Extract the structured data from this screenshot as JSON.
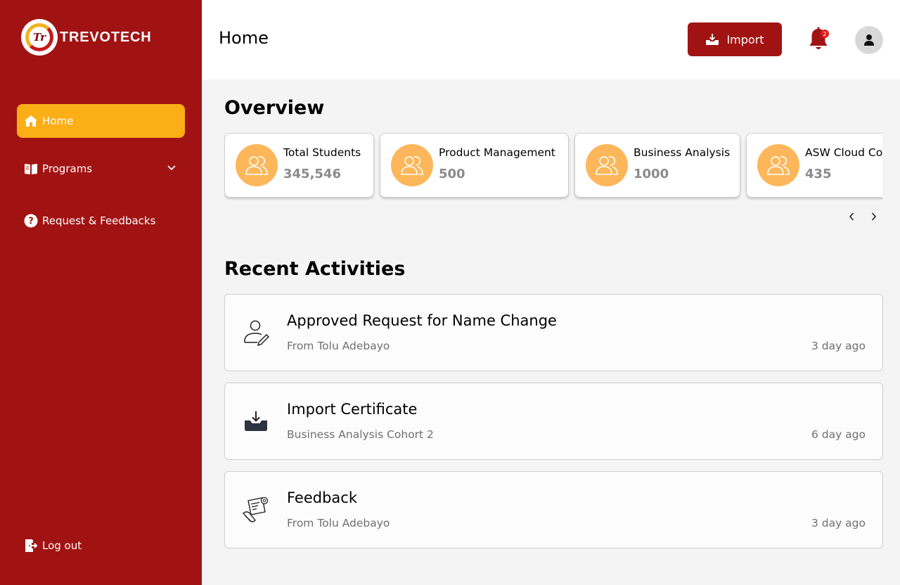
{
  "brand": {
    "name": "TREVOTECH",
    "logo_letters": "Tr"
  },
  "colors": {
    "sidebar": "#a11313",
    "accent": "#fcae17",
    "card_circle": "#fdb75a",
    "badge": "#e21b1b"
  },
  "sidebar": {
    "items": [
      {
        "label": "Home",
        "icon": "home-icon",
        "active": true
      },
      {
        "label": "Programs",
        "icon": "book-icon",
        "has_dropdown": true
      },
      {
        "label": "Request & Feedbacks",
        "icon": "question-icon"
      }
    ],
    "logout_label": "Log out"
  },
  "header": {
    "title": "Home",
    "import_label": "Import",
    "notification_count": "2"
  },
  "overview": {
    "title": "Overview",
    "cards": [
      {
        "label": "Total Students",
        "value": "345,546"
      },
      {
        "label": "Product Management",
        "value": "500"
      },
      {
        "label": "Business Analysis",
        "value": "1000"
      },
      {
        "label": "ASW Cloud Computing",
        "value": "435"
      }
    ],
    "prev_icon": "chevron-left-icon",
    "next_icon": "chevron-right-icon"
  },
  "activities": {
    "title": "Recent Activities",
    "items": [
      {
        "title": "Approved Request for Name Change",
        "subtitle": "From Tolu Adebayo",
        "time": "3 day ago",
        "icon": "user-edit-icon"
      },
      {
        "title": "Import Certificate",
        "subtitle": "Business Analysis Cohort 2",
        "time": "6 day ago",
        "icon": "import-tray-icon"
      },
      {
        "title": "Feedback",
        "subtitle": "From Tolu Adebayo",
        "time": "3 day ago",
        "icon": "certificate-icon"
      }
    ]
  }
}
